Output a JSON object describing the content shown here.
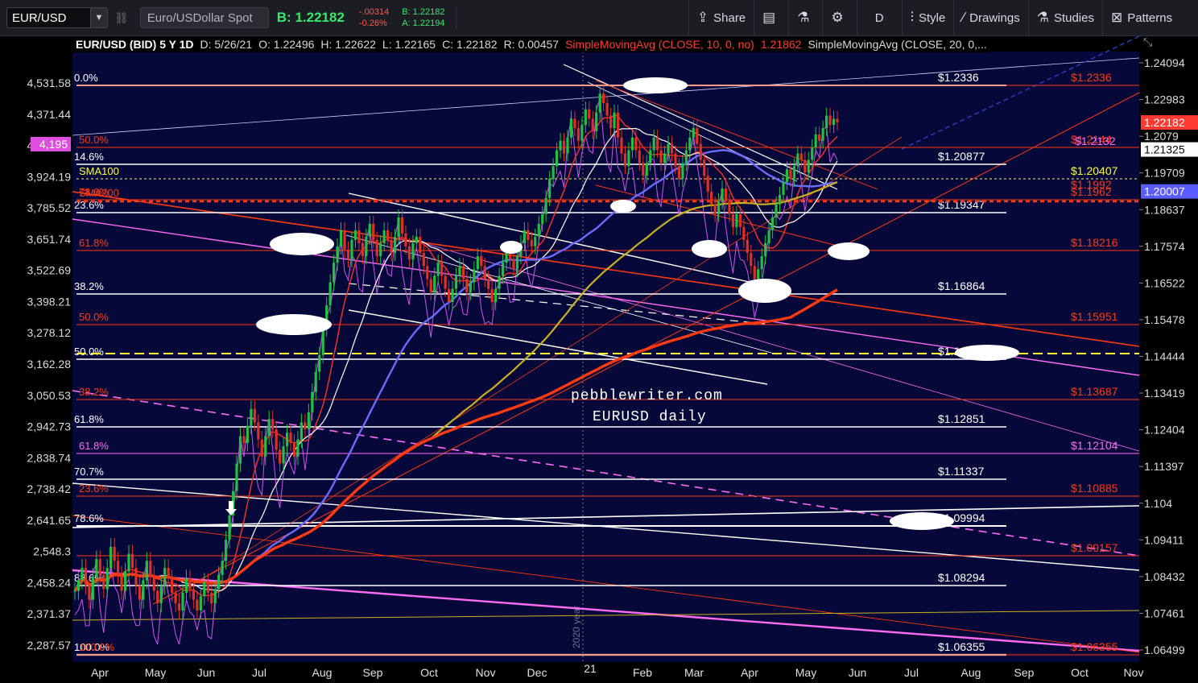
{
  "toolbar": {
    "symbol": "EUR/USD",
    "description": "Euro/USDollar Spot",
    "bid": "B: 1.22182",
    "change": "-.00314",
    "change_pct": "-0.26%",
    "bid_small": "B: 1.22182",
    "ask_small": "A: 1.22194",
    "share": "Share",
    "style": "Style",
    "drawings": "Drawings",
    "studies": "Studies",
    "patterns": "Patterns",
    "aggregation": "D"
  },
  "info": {
    "symbol": "EUR/USD (BID) 5 Y 1D",
    "date": "D: 5/26/21",
    "open": "O: 1.22496",
    "high": "H: 1.22622",
    "low": "L: 1.22165",
    "close": "C: 1.22182",
    "range": "R: 0.00457",
    "sma10": "SimpleMovingAvg (CLOSE, 10, 0, no)",
    "sma10_val": "1.21862",
    "sma20": "SimpleMovingAvg (CLOSE, 20, 0,..."
  },
  "overlay": {
    "watermark": "pebblewriter.com",
    "subtitle": "EURUSD daily",
    "year_label": "2020 year",
    "sep_label": "21"
  },
  "colors": {
    "background": "#06083a",
    "candle_up": "#22c040",
    "candle_down": "#e03020",
    "sma10": "#ff3020",
    "sma20": "#ffffff",
    "sma50": "#6a6cff",
    "sma100": "#c8b020",
    "sma200": "#ff3a10",
    "oscillator": "#cc55ee",
    "fib_white": "#ffffff",
    "fib_red": "#ff3a10",
    "fib_pink": "#ff6cf0",
    "fib_yellow": "#ffff30"
  },
  "chart_data": {
    "type": "candlestick",
    "x_labels": [
      "Apr",
      "May",
      "Jun",
      "Jul",
      "Aug",
      "Sep",
      "Oct",
      "Nov",
      "Dec",
      "21",
      "Feb",
      "Mar",
      "Apr",
      "May",
      "Jun",
      "Jul",
      "Aug",
      "Sep",
      "Oct",
      "Nov"
    ],
    "right_axis_ticks": [
      "1.24094",
      "1.22983",
      "1.2079",
      "1.19709",
      "1.18637",
      "1.17574",
      "1.16522",
      "1.15478",
      "1.14444",
      "1.13419",
      "1.12404",
      "1.11397",
      "1.104",
      "1.09411",
      "1.08432",
      "1.07461",
      "1.06499"
    ],
    "left_axis_ticks": [
      "4,531.58",
      "4,371.44",
      "4,067.94",
      "3,924.19",
      "3,785.52",
      "3,651.74",
      "3,522.69",
      "3,398.21",
      "3,278.12",
      "3,162.28",
      "3,050.53",
      "2,942.73",
      "2,838.74",
      "2,738.42",
      "2,641.65",
      "2,548.3",
      "2,458.24",
      "2,371.37",
      "2,287.57"
    ],
    "left_marker": "4,195",
    "price_badges": [
      {
        "value": "1.22182",
        "color": "#ff3a30"
      },
      {
        "value": "1.21325",
        "color": "#ffffff"
      },
      {
        "value": "1.20007",
        "color": "#5a5cff"
      }
    ],
    "candles_close": [
      1.0815,
      1.0845,
      1.088,
      1.083,
      1.079,
      1.0855,
      1.0905,
      1.086,
      1.082,
      1.088,
      1.094,
      1.09,
      1.086,
      1.0815,
      1.087,
      1.092,
      1.088,
      1.083,
      1.079,
      1.0845,
      1.09,
      1.086,
      1.0815,
      1.078,
      1.083,
      1.088,
      1.085,
      1.081,
      1.078,
      1.076,
      1.081,
      1.085,
      1.082,
      1.079,
      1.076,
      1.08,
      1.084,
      1.081,
      1.078,
      1.082,
      1.086,
      1.09,
      1.096,
      1.103,
      1.11,
      1.118,
      1.126,
      1.124,
      1.129,
      1.134,
      1.13,
      1.125,
      1.12,
      1.126,
      1.131,
      1.128,
      1.122,
      1.118,
      1.123,
      1.127,
      1.124,
      1.12,
      1.125,
      1.13,
      1.128,
      1.133,
      1.139,
      1.145,
      1.15,
      1.158,
      1.165,
      1.172,
      1.178,
      1.183,
      1.188,
      1.182,
      1.179,
      1.185,
      1.188,
      1.184,
      1.18,
      1.186,
      1.19,
      1.185,
      1.18,
      1.184,
      1.188,
      1.185,
      1.181,
      1.186,
      1.192,
      1.187,
      1.183,
      1.179,
      1.184,
      1.186,
      1.181,
      1.177,
      1.173,
      1.169,
      1.174,
      1.178,
      1.174,
      1.17,
      1.166,
      1.17,
      1.174,
      1.177,
      1.173,
      1.169,
      1.172,
      1.176,
      1.18,
      1.177,
      1.173,
      1.17,
      1.166,
      1.17,
      1.174,
      1.178,
      1.182,
      1.179,
      1.176,
      1.18,
      1.184,
      1.188,
      1.185,
      1.183,
      1.186,
      1.19,
      1.193,
      1.198,
      1.204,
      1.208,
      1.213,
      1.216,
      1.212,
      1.217,
      1.223,
      1.22,
      1.216,
      1.221,
      1.226,
      1.223,
      1.219,
      1.225,
      1.231,
      1.228,
      1.224,
      1.22,
      1.225,
      1.217,
      1.212,
      1.208,
      1.213,
      1.217,
      1.213,
      1.209,
      1.205,
      1.209,
      1.213,
      1.217,
      1.213,
      1.209,
      1.212,
      1.215,
      1.212,
      1.208,
      1.204,
      1.209,
      1.213,
      1.217,
      1.22,
      1.215,
      1.21,
      1.205,
      1.2,
      1.196,
      1.193,
      1.197,
      1.201,
      1.197,
      1.193,
      1.189,
      1.193,
      1.189,
      1.185,
      1.181,
      1.177,
      1.173,
      1.176,
      1.18,
      1.184,
      1.188,
      1.192,
      1.196,
      1.199,
      1.203,
      1.207,
      1.204,
      1.208,
      1.212,
      1.21,
      1.206,
      1.21,
      1.214,
      1.218,
      1.216,
      1.22,
      1.224,
      1.221,
      1.223,
      1.2218
    ]
  }
}
